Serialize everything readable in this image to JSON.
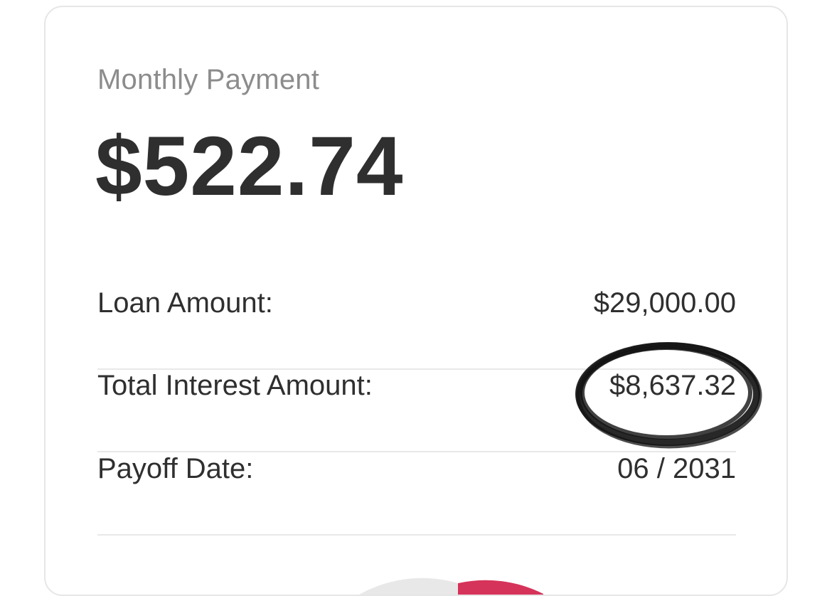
{
  "summary": {
    "monthly_label": "Monthly Payment",
    "monthly_value": "$522.74"
  },
  "details": [
    {
      "label": "Loan Amount:",
      "value": "$29,000.00"
    },
    {
      "label": "Total Interest Amount:",
      "value": "$8,637.32"
    },
    {
      "label": "Payoff Date:",
      "value": "06 / 2031"
    }
  ],
  "colors": {
    "principal_slice": "#e8e8e8",
    "interest_slice": "#d6335a",
    "scribble": "#111111"
  }
}
